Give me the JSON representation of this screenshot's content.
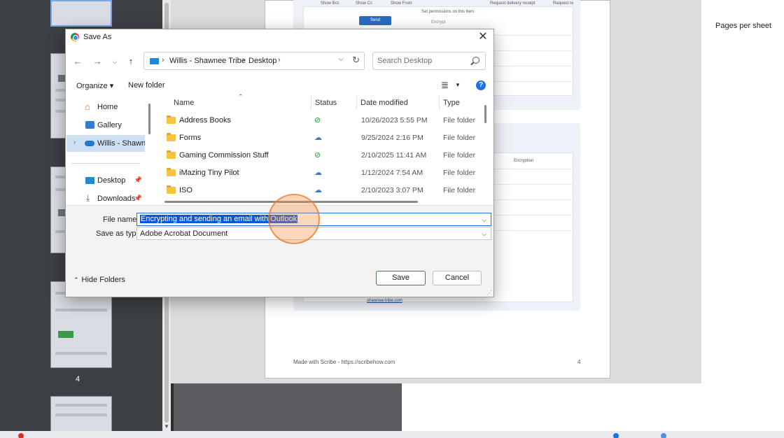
{
  "background": {
    "preview_page": {
      "toolbar_labels": [
        "Show Bcc",
        "Show Cc",
        "Show From",
        "Request delivery receipt",
        "Request re"
      ],
      "send_button": "Send",
      "tooltip": "Set permissions on this item",
      "encrypt_label": "Encrypt",
      "encryption_label": "Encryption",
      "link_text": "shawnee-tribe.com",
      "footer_credit": "Made with Scribe - https://scribehow.com",
      "footer_page_number": "4"
    },
    "thumbnail_page_number": "4",
    "print_settings": {
      "pages_per_sheet_label": "Pages per sheet"
    }
  },
  "dialog": {
    "title": "Save As",
    "close_icon": "close-icon",
    "nav": {
      "back_icon": "arrow-left-icon",
      "forward_icon": "arrow-right-icon",
      "recent_icon": "chevron-down-icon",
      "up_icon": "arrow-up-icon"
    },
    "address": {
      "crumbs": [
        "Willis - Shawnee Tribe",
        "Desktop"
      ]
    },
    "search": {
      "placeholder": "Search Desktop"
    },
    "commands": {
      "organize": "Organize ▾",
      "new_folder": "New folder"
    },
    "navigation_pane": {
      "items": [
        {
          "label": "Home",
          "icon": "home-icon"
        },
        {
          "label": "Gallery",
          "icon": "gallery-icon"
        },
        {
          "label": "Willis - Shawnee Tribe",
          "icon": "cloud-icon",
          "selected": true
        },
        {
          "label": "Desktop",
          "icon": "desktop-icon",
          "pinned": true
        },
        {
          "label": "Downloads",
          "icon": "download-icon",
          "pinned": true
        }
      ]
    },
    "file_list": {
      "columns": [
        "Name",
        "Status",
        "Date modified",
        "Type"
      ],
      "rows": [
        {
          "name": "Address Books",
          "status": "synced",
          "date": "10/26/2023 5:55 PM",
          "type": "File folder"
        },
        {
          "name": "Forms",
          "status": "cloud",
          "date": "9/25/2024 2:16 PM",
          "type": "File folder"
        },
        {
          "name": "Gaming Commission Stuff",
          "status": "synced",
          "date": "2/10/2025 11:41 AM",
          "type": "File folder"
        },
        {
          "name": "iMazing Tiny Pilot",
          "status": "cloud",
          "date": "1/12/2024 7:54 AM",
          "type": "File folder"
        },
        {
          "name": "ISO",
          "status": "cloud",
          "date": "2/10/2023 3:07 PM",
          "type": "File folder"
        }
      ]
    },
    "form": {
      "file_name_label": "File name:",
      "file_name_value": "Encrypting and sending an email with Outlook",
      "save_as_type_label": "Save as type:",
      "save_as_type_value": "Adobe Acrobat Document"
    },
    "buttons": {
      "hide_folders": "Hide Folders",
      "save": "Save",
      "cancel": "Cancel"
    },
    "accent_color": "#1a73e8"
  }
}
